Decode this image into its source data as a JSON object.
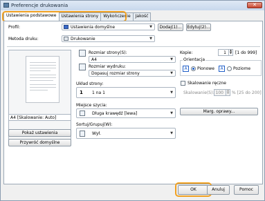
{
  "window": {
    "title": "Preferencje drukowania",
    "close_icon": "close-icon"
  },
  "tabs": [
    {
      "label": "Ustawienia podstawowe",
      "active": true
    },
    {
      "label": "Ustawienia strony"
    },
    {
      "label": "Wykończenie"
    },
    {
      "label": "Jakość"
    }
  ],
  "profile": {
    "label": "Profil:",
    "value": "Ustawienia domyślne",
    "add_button": "Dodaj(1)...",
    "edit_button": "Edytuj(2)..."
  },
  "print_method": {
    "label": "Metoda druku:",
    "value": "Drukowanie"
  },
  "preview": {
    "caption": "A4 [Skalowanie: Auto]"
  },
  "left_buttons": {
    "show_settings": "Pokaż ustawienia",
    "restore_defaults": "Przywróć domyślne"
  },
  "page_size": {
    "label": "Rozmiar strony(S):",
    "value": "A4"
  },
  "output_size": {
    "label": "Rozmiar wydruku:",
    "value": "Dopasuj rozmiar strony"
  },
  "layout": {
    "label": "Układ strony:",
    "value": "1 na 1",
    "icon_text": "1"
  },
  "binding": {
    "label": "Miejsce szycia:",
    "value": "Długa krawędź [lewa]",
    "margin_button": "Marg. oprawy..."
  },
  "collate": {
    "label": "Sortuj/Grupuj(W):",
    "value": "Wył."
  },
  "copies": {
    "label": "Kopie:",
    "value": "1",
    "range": "[1 do 999]"
  },
  "orientation": {
    "label": "Orientacja",
    "portrait": "Pionowe",
    "landscape": "Poziome",
    "selected": "portrait"
  },
  "scaling": {
    "checkbox_label": "Skalowanie ręczne",
    "field_label": "Skalowanie(S):",
    "value": "100",
    "range": "% [25 do 200]"
  },
  "footer": {
    "ok": "OK",
    "cancel": "Anuluj",
    "help": "Pomoc"
  }
}
